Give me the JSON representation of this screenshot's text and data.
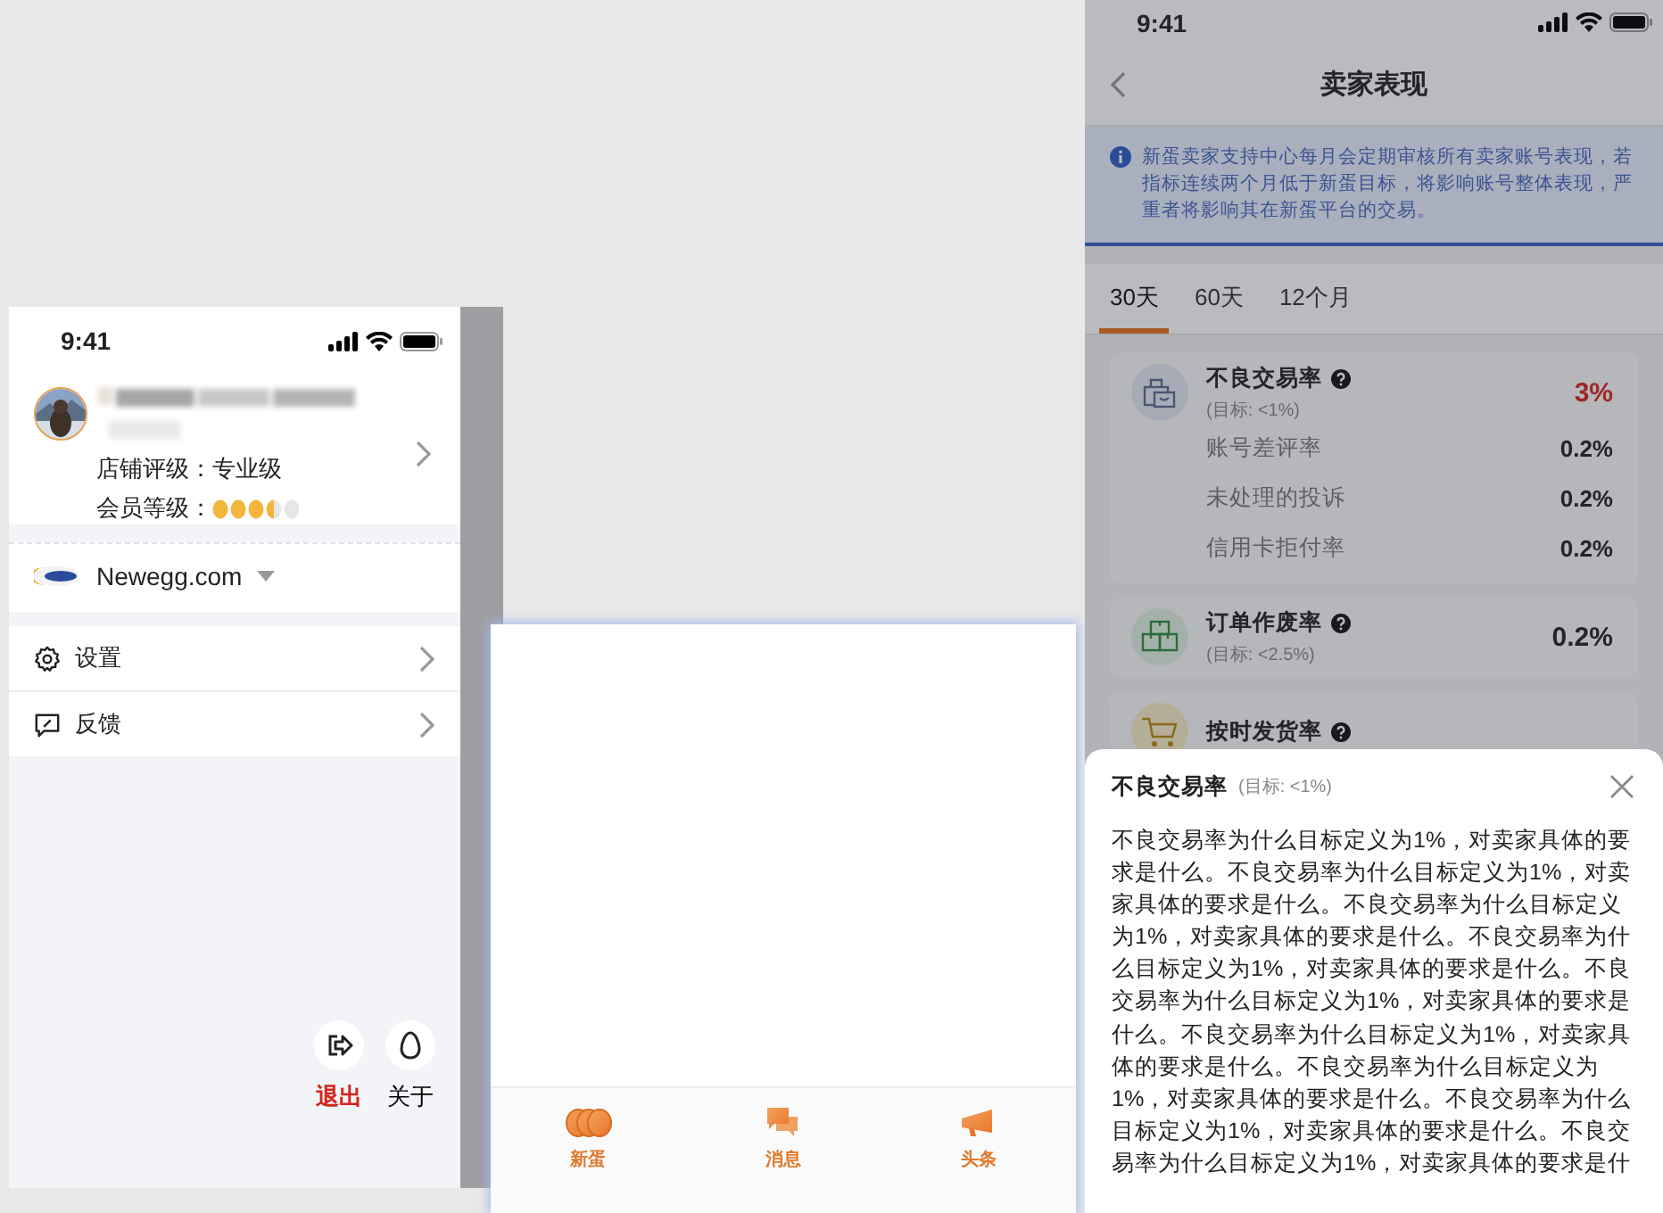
{
  "left_phone": {
    "status_bar": {
      "time": "9:41"
    },
    "profile": {
      "store_rating_label": "店铺评级：",
      "store_rating": "专业级",
      "member_level_label": "会员等级：",
      "stars": 3.5
    },
    "platform": {
      "name": "Newegg.com"
    },
    "menu": [
      {
        "label": "设置",
        "kind": "settings"
      },
      {
        "label": "反馈",
        "kind": "feedback"
      }
    ],
    "actions": [
      {
        "label": "退出",
        "kind": "logout"
      },
      {
        "label": "关于",
        "kind": "about"
      }
    ]
  },
  "middle_phone": {
    "tab_bar": [
      {
        "label": "新蛋",
        "kind": "eggs"
      },
      {
        "label": "消息",
        "kind": "messages"
      },
      {
        "label": "头条",
        "kind": "news"
      }
    ]
  },
  "right_phone": {
    "status_bar": {
      "time": "9:41"
    },
    "title": "卖家表现",
    "notice": "新蛋卖家支持中心每月会定期审核所有卖家账号表现，若指标连续两个月低于新蛋目标，将影响账号整体表现，严重者将影响其在新蛋平台的交易。",
    "tabs": [
      {
        "label": "30天",
        "selected": true
      },
      {
        "label": "60天",
        "selected": false
      },
      {
        "label": "12个月",
        "selected": false
      }
    ],
    "metrics": [
      {
        "kind": "bag",
        "title": "不良交易率",
        "target": "(目标: <1%)",
        "value": "3%",
        "alert": true,
        "details": [
          {
            "label": "账号差评率",
            "value": "0.2%"
          },
          {
            "label": "未处理的投诉",
            "value": "0.2%"
          },
          {
            "label": "信用卡拒付率",
            "value": "0.2%"
          }
        ]
      },
      {
        "kind": "boxes",
        "title": "订单作废率",
        "target": "(目标: <2.5%)",
        "value": "0.2%",
        "alert": false
      },
      {
        "kind": "cart",
        "title": "按时发货率"
      }
    ],
    "sheet": {
      "title": "不良交易率",
      "target": "(目标: <1%)",
      "body": "不良交易率为什么目标定义为1%，对卖家具体的要求是什么。不良交易率为什么目标定义为1%，对卖家具体的要求是什么。不良交易率为什么目标定义为1%，对卖家具体的要求是什么。不良交易率为什么目标定义为1%，对卖家具体的要求是什么。不良交易率为什么目标定义为1%，对卖家具体的要求是什么。不良交易率为什么目标定义为1%，对卖家具体的要求是什么。不良交易率为什么目标定义为1%，对卖家具体的要求是什么。不良交易率为什么目标定义为1%，对卖家具体的要求是什么。不良交易率为什么目标定义为1%，对卖家具体的要求是什"
    }
  }
}
